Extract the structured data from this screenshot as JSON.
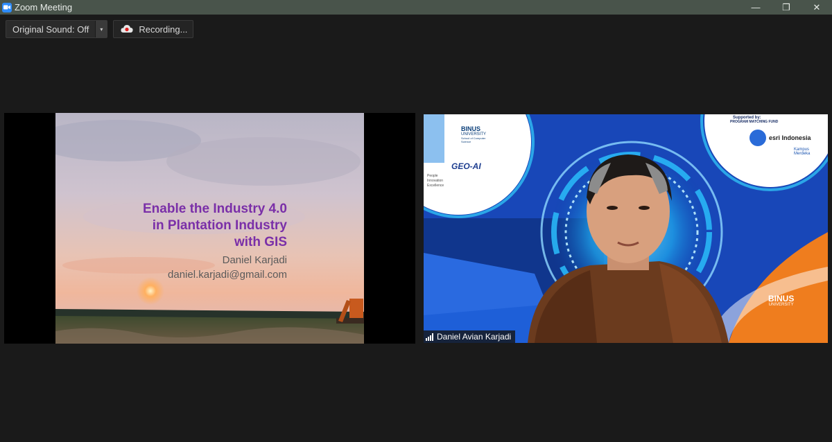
{
  "window": {
    "title": "Zoom Meeting",
    "minimize_glyph": "—",
    "restore_glyph": "❐",
    "close_glyph": "✕"
  },
  "toolbar": {
    "original_sound_label": "Original Sound: Off",
    "original_sound_caret": "▾",
    "recording_label": "Recording..."
  },
  "shared_slide": {
    "title_lines": [
      "Enable the Industry 4.0",
      "in Plantation Industry",
      "with GIS"
    ],
    "presenter": "Daniel Karjadi",
    "email": "daniel.karjadi@gmail.com"
  },
  "participant_video": {
    "name": "Daniel Avian Karjadi",
    "background_text": {
      "university": "BINUS",
      "university_sub": "UNIVERSITY",
      "school": "School of Computer Science",
      "lab": "GEO-AI",
      "tagline": [
        "People",
        "Innovation",
        "Excellence"
      ],
      "supported_by": "Supported by:",
      "program": "PROGRAM MATCHING FUND",
      "partner": "esri Indonesia",
      "kampus": "Kampus Merdeka",
      "binus_logo": "BINUS",
      "binus_logo_sub": "UNIVERSITY"
    }
  },
  "colors": {
    "titlebar": "#49544b",
    "background": "#1a1a1a",
    "zoom_blue": "#2d8cff",
    "slide_title": "#7a2fa8",
    "recording_red": "#e02020"
  },
  "icons": {
    "app": "zoom-camera-icon",
    "recording": "cloud-record-icon",
    "signal": "signal-bars-icon"
  }
}
